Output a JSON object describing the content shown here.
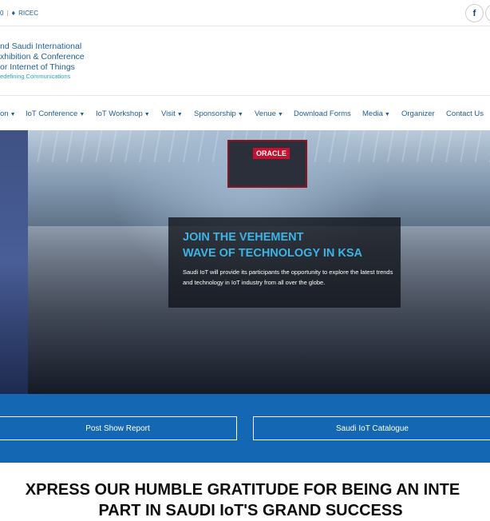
{
  "topbar": {
    "contact_prefix": "0",
    "location_label": "RICEC",
    "social": [
      {
        "name": "facebook",
        "glyph": "f"
      }
    ]
  },
  "logo": {
    "line1": "nd Saudi International",
    "line2": "xhibition & Conference",
    "line3": "or Internet of Things",
    "tagline": "edefining Communications"
  },
  "nav": {
    "items": [
      {
        "label": "on",
        "caret": true
      },
      {
        "label": "IoT Conference",
        "caret": true
      },
      {
        "label": "IoT Workshop",
        "caret": true
      },
      {
        "label": "Visit",
        "caret": true
      },
      {
        "label": "Sponsorship",
        "caret": true
      },
      {
        "label": "Venue",
        "caret": true
      },
      {
        "label": "Download Forms",
        "caret": false
      },
      {
        "label": "Media",
        "caret": true
      },
      {
        "label": "Organizer",
        "caret": false
      },
      {
        "label": "Contact Us",
        "caret": false
      }
    ]
  },
  "hero": {
    "booth_sign": "ORACLE",
    "title_line1": "JOIN THE VEHEMENT",
    "title_line2": "WAVE OF TECHNOLOGY IN KSA",
    "body": "Saudi IoT will provide its participants the opportunity to explore the latest trends and technology in IoT industry from all over the globe."
  },
  "cta": {
    "report_label": "Post Show Report",
    "catalogue_label": "Saudi IoT Catalogue"
  },
  "headline": {
    "line1": "XPRESS OUR HUMBLE GRATITUDE FOR BEING AN INTE",
    "line2": "PART IN SAUDI IoT'S GRAND SUCCESS"
  },
  "colors": {
    "brand_blue": "#1f5e96",
    "band_blue": "#1468b3",
    "hero_title": "#3bb4e6",
    "tagline_teal": "#2aa5b7"
  }
}
